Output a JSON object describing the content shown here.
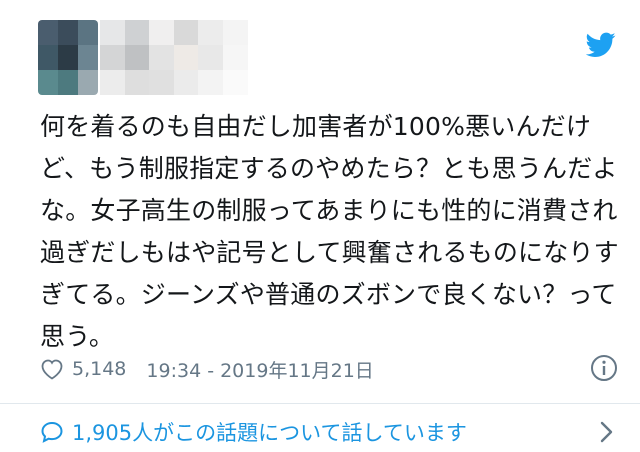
{
  "tweet": {
    "text": "何を着るのも自由だし加害者が100%悪いんだけど、もう制服指定するのやめたら？とも思うんだよな。女子高生の制服ってあまりにも性的に消費され過ぎだしもはや記号として興奮されるものになりすぎてる。ジーンズや普通のズボンで良くない？って思う。",
    "likes": "5,148",
    "timestamp": "19:34 - 2019年11月21日"
  },
  "footer": {
    "talking_label": "1,905人がこの話題について話しています"
  },
  "icons": {
    "brand": "twitter-bird-icon",
    "like": "heart-icon",
    "info": "info-icon",
    "conversation": "comment-icon",
    "more": "chevron-right-icon"
  },
  "colors": {
    "brand_blue": "#1da1f2",
    "link_blue": "#1b95e0",
    "muted_gray": "#657786",
    "text": "#14171a",
    "divider": "#e1e8ed"
  },
  "mosaic": {
    "avatar_cells": [
      "#4a5d6e",
      "#3b4c5b",
      "#5b7482",
      "#3f5866",
      "#2c3b46",
      "#6c8592",
      "#5a8a8e",
      "#4d7a7f",
      "#9aa9b0"
    ],
    "name_cells": [
      "#e6e7e8",
      "#cfd1d3",
      "#f0efef",
      "#d9d9d9",
      "#ececec",
      "#f4f4f4",
      "#d4d5d6",
      "#bfc1c3",
      "#e3e3e3",
      "#eeeae6",
      "#e8e8e8",
      "#f6f6f6",
      "#ececec",
      "#dedede",
      "#e0e0e0",
      "#ebebeb",
      "#f3f3f3",
      "#fafafa"
    ]
  }
}
